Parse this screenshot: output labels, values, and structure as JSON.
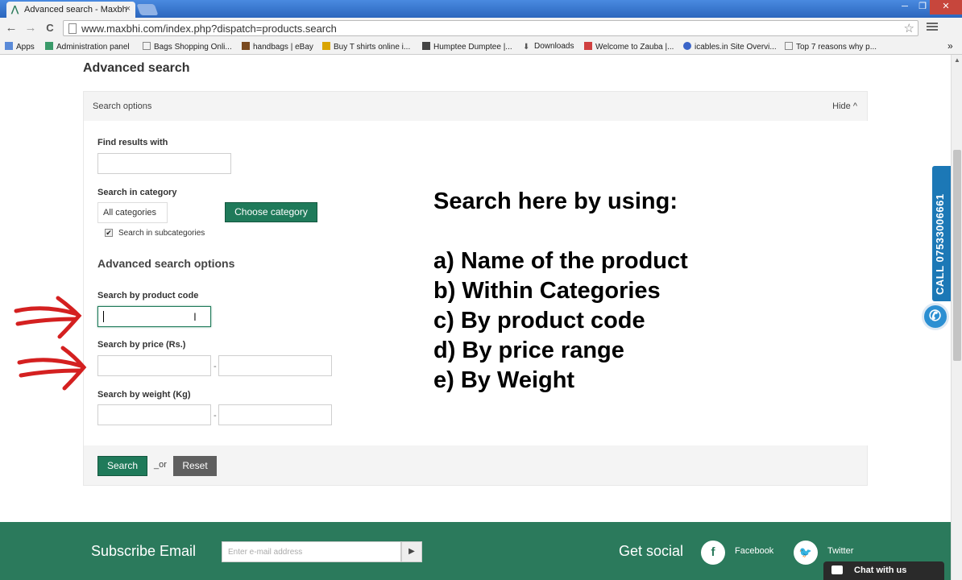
{
  "browser": {
    "tab_title": "Advanced search - Maxbh",
    "tab_icon": "maxbhi-logo-icon",
    "tab_close": "×",
    "url": "www.maxbhi.com/index.php?dispatch=products.search",
    "win_min": "─",
    "win_max": "❐",
    "win_close": "✕",
    "back": "←",
    "forward": "→",
    "reload": "C",
    "star": "☆",
    "bookmarks": [
      {
        "label": "Apps",
        "icon": "apps-grid-icon"
      },
      {
        "label": "Administration panel",
        "icon": "bookmark-site-icon"
      },
      {
        "label": "Bags Shopping Onli...",
        "icon": "page-icon"
      },
      {
        "label": "handbags | eBay",
        "icon": "bookmark-site-icon"
      },
      {
        "label": "Buy T shirts online i...",
        "icon": "bookmark-site-icon"
      },
      {
        "label": "Humptee Dumptee |...",
        "icon": "bookmark-site-icon"
      },
      {
        "label": "Downloads",
        "icon": "download-icon"
      },
      {
        "label": "Welcome to Zauba |...",
        "icon": "bookmark-site-icon"
      },
      {
        "label": "icables.in Site Overvi...",
        "icon": "bookmark-site-icon"
      },
      {
        "label": "Top 7 reasons why p...",
        "icon": "page-icon"
      }
    ],
    "bookmarks_more": "»"
  },
  "page": {
    "title": "Advanced search",
    "search_options_label": "Search options",
    "hide_label": "Hide ^",
    "find_results_label": "Find results with",
    "find_results_value": "",
    "search_in_category_label": "Search in category",
    "category_value": "All categories",
    "choose_category_label": "Choose category",
    "subcategories_label": "Search in subcategories",
    "subcategories_checked": "✔",
    "advanced_options_title": "Advanced search options",
    "product_code_label": "Search by product code",
    "product_code_value": "",
    "price_label": "Search by price (Rs.)",
    "weight_label": "Search by weight (Kg)",
    "range_dash": "-",
    "search_button": "Search",
    "or_text": "_or",
    "reset_button": "Reset"
  },
  "annotation": {
    "heading": "Search here by using:",
    "items": [
      "a) Name of the product",
      "b) Within Categories",
      "c) By product code",
      "d) By price range",
      "e) By Weight"
    ],
    "arrow_color": "#d42020"
  },
  "side_call": {
    "text": "CALL 07533006661",
    "icon": "phone-icon"
  },
  "footer": {
    "subscribe_label": "Subscribe Email",
    "email_placeholder": "Enter e-mail address",
    "go_symbol": "▶",
    "social_label": "Get social",
    "facebook_label": "Facebook",
    "facebook_glyph": "f",
    "twitter_label": "Twitter",
    "chat_label": "Chat with us"
  },
  "colors": {
    "brand_green": "#1f7a5a",
    "footer_green": "#2b7a5c",
    "call_blue": "#1c78b6"
  }
}
